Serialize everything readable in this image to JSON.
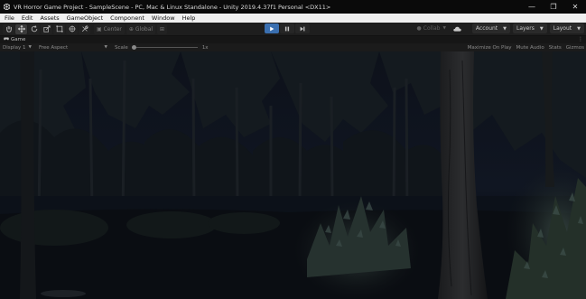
{
  "window": {
    "title": "VR Horror Game Project - SampleScene - PC, Mac & Linux Standalone - Unity 2019.4.37f1 Personal <DX11>",
    "controls": [
      "—",
      "❐",
      "✕"
    ]
  },
  "menu": {
    "items": [
      "File",
      "Edit",
      "Assets",
      "GameObject",
      "Component",
      "Window",
      "Help"
    ]
  },
  "toolbar": {
    "tools": [
      "hand-icon",
      "move-icon",
      "rotate-icon",
      "scale-icon",
      "rect-icon",
      "transform-icon",
      "custom-tool-icon"
    ],
    "pivot_label": "Center",
    "space_label": "Global",
    "collab_label": "Collab",
    "account_label": "Account",
    "layers_label": "Layers",
    "layout_label": "Layout"
  },
  "game_tab": {
    "label": "Game"
  },
  "game_toolbar": {
    "display_label": "Display 1",
    "aspect_label": "Free Aspect",
    "scale_label": "Scale",
    "scale_value": "1x",
    "options": [
      "Maximize On Play",
      "Mute Audio",
      "Stats",
      "Gizmos"
    ]
  },
  "colors": {
    "play_active": "#3a6fb0",
    "sky": "#0c1018",
    "ground": "#0a0d12",
    "foliage": "#1e2a2c"
  }
}
